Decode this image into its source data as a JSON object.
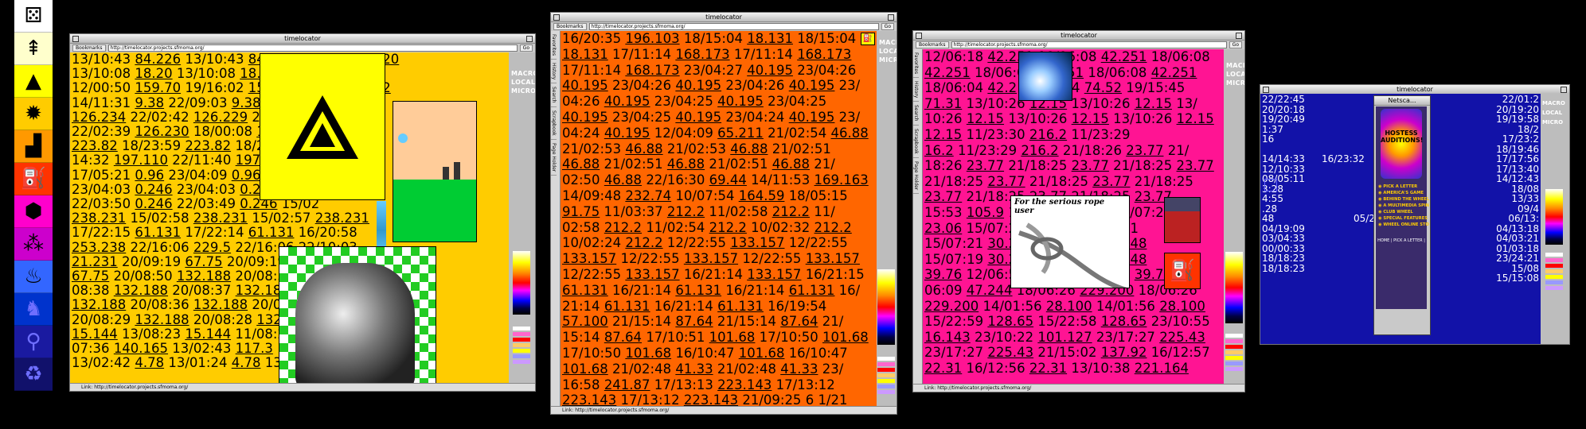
{
  "palette": {
    "items": [
      {
        "icon": "dice-icon",
        "glyph": "⚄",
        "color": "#ffffff"
      },
      {
        "icon": "tree-icon",
        "glyph": "⇞",
        "color": "#ffffcc"
      },
      {
        "icon": "triangle-icon",
        "glyph": "▲",
        "color": "#ffff00"
      },
      {
        "icon": "gear-icon",
        "glyph": "✹",
        "color": "#ffcc00"
      },
      {
        "icon": "factory-icon",
        "glyph": "▟",
        "color": "#ff9900"
      },
      {
        "icon": "fuel-pump-icon",
        "glyph": "⛽",
        "color": "#ff3300"
      },
      {
        "icon": "cube-icon",
        "glyph": "⬢",
        "color": "#ff00cc"
      },
      {
        "icon": "drops-icon",
        "glyph": "⁂",
        "color": "#cc00cc"
      },
      {
        "icon": "fire-icon",
        "glyph": "♨",
        "color": "#3366ff"
      },
      {
        "icon": "animal-icon",
        "glyph": "♞",
        "color": "#0033cc"
      },
      {
        "icon": "runner-icon",
        "glyph": "⚲",
        "color": "#1a1aa0"
      },
      {
        "icon": "recycle-icon",
        "glyph": "♻",
        "color": "#11116b"
      }
    ]
  },
  "common": {
    "window_title": "timelocator",
    "url": "http://timelocator.projects.sfmoma.org/",
    "status": "Link: http://timelocator.projects.sfmoma.org/",
    "toolbar_btn": "Bookmarks",
    "go_btn": "Go",
    "side_labels": [
      "MACRO",
      "LOCAL",
      "MICRO"
    ],
    "vtabs": [
      "Favorites",
      "History",
      "Search",
      "Scrapbook",
      "Page Holder"
    ]
  },
  "win1": {
    "bg": "#ffcc00",
    "text": "#000000",
    "rows": [
      "13/10:43 84.226 13/10:43 84.226 13/10:08 18.20",
      "13/10:08 18.20 13/10:08 18.20 22/06:52 1.227",
      "12/00:50 159.70 19/16:02 159.70 19/16:02 1.22",
      "14/11:31 9.38 22/09:03 9.38 22/09:03 14/11",
      "126.234 22/02:42 126.229 22/02:42 126.234",
      "22/02:39 126.230 18/00:08 126.230 18/00",
      "223.82 18/23:59 223.82 18/23:59 223.82",
      "14:32 197.110 22/11:40 197.110 22/11:40",
      "17/05:21 0.96 23/04:09 0.96 23/04:09 0.96",
      "23/04:03 0.246 23/04:03 0.246 23/04:03",
      "22/03:50 0.246 22/03:49 0.246 15/02",
      "238.231 15/02:58 238.231 15/02:57 238.231",
      "17/22:15 61.131 17/22:14 61.131 16/20:58",
      "253.238 22/16:06 229.5 22/16:06 22/10:03",
      "21.231 20/09:19 67.75 20/09:19 15/08:00",
      "67.75 20/08:50 132.188 20/08:50 132.188",
      "08:38 132.188 20/08:37 132.188 20/08",
      "132.188 20/08:36 132.188 20/08:36 132.188",
      "20/08:29 132.188 20/08:28 132.188 13/08:23",
      "15.144 13/08:23 15.144 11/08:23 232.86",
      "07:36 140.165 13/02:43 117.3 15/14 4.78",
      "13/02:42 4.78 13/01:24 4.78 13/01"
    ]
  },
  "win2": {
    "bg": "#ff6600",
    "text": "#000000",
    "rows": [
      "16/20:35 196.103 18/15:04 18.131 18/15:04",
      "18.131 17/11:14 168.173 17/11:14 168.173",
      "17/11:14 168.173 23/04:27 40.195 23/04:26",
      "40.195 23/04:26 40.195 23/04:26 40.195 23/",
      "04:26 40.195 23/04:25 40.195 23/04:25",
      "40.195 23/04:25 40.195 23/04:24 40.195 23/",
      "04:24 40.195 12/04:09 65.211 21/02:54 46.88",
      "21/02:53 46.88 21/02:53 46.88 21/02:51",
      "46.88 21/02:51 46.88 21/02:51 46.88 21/",
      "02:50 46.88 22/16:30 69.44 14/11:53 169.163",
      "14/09:48 232.74 10/07:54 164.59 18/05:15",
      "91.75 11/03:37 212.2 11/02:58 212.2 11/",
      "02:58 212.2 11/02:54 212.2 10/02:32 212.2",
      "10/02:24 212.2 12/22:55 133.157 12/22:55",
      "133.157 12/22:55 133.157 12/22:55 133.157",
      "12/22:55 133.157 16/21:14 133.157 16/21:15",
      "61.131 16/21:14 61.131 16/21:14 61.131 16/",
      "21:14 61.131 16/21:14 61.131 16/19:54",
      "57.100 21/15:14 87.64 21/15:14 87.64 21/",
      "15:14 87.64 17/10:51 101.68 17/10:50 101.68",
      "17/10:50 101.68 16/10:47 101.68 16/10:47",
      "101.68 21/02:48 41.33 21/02:48 41.33 23/",
      "16:58 241.87 17/13:13 223.143 17/13:12",
      "223.143 17/13:12 223.143 21/09:25 6 1/21"
    ]
  },
  "win3": {
    "bg": "#ff1493",
    "text": "#000000",
    "ad_caption": "For the serious rope user",
    "rows": [
      "12/06:18 42.251 18/06:08 42.251 18/06:08",
      "42.251 18/06:08 42.251 18/06:08 42.251",
      "18/06:04 42.2 13/13:14 74.52 19/15:45",
      "71.31 13/10:26 12.15 13/10:26 12.15 13/",
      "10:26 12.15 13/10:26 12.15 13/10:26 12.15",
      "12.15 11/23:30 216.2 11/23:29",
      "16.2 11/23:29 216.2 21/18:26 23.77 21/",
      "18:26 23.77 21/18:25 23.77 21/18:25 23.77",
      "21/18:25 23.77 21/18:25 23.77 21/18:25",
      "23.77 21/18:25 23.77 21/18:25 23.77",
      "15:53 105.9 13/08:27 16.87 11/07:21",
      "23.06 15/07:21 30.248 15/07:21",
      "15/07:21 30.248 15/07:20 30.248",
      "15/07:19 30.248 15/07:19 30.248",
      "39.76 12/06:53 39.76 12/06:53 39.76",
      "06:09 47.244 18/06:26 229.200 18/06:26",
      "229.200 14/01:56 28.100 14/01:56 28.100",
      "15/22:59 128.65 15/22:58 128.65 23/10:55",
      "16.143 23/10:22 101.127 23/17:27 225.43",
      "23/17:27 225.43 21/15:02 137.92 16/12:57",
      "22.31 16/12:56 22.31 13/10:38 221.164"
    ]
  },
  "win4": {
    "bg": "#1212a8",
    "text": "#ffffff",
    "left_rows": [
      "22/22:45",
      "20/20:18",
      "19/20:49",
      "1:37",
      "16",
      "",
      "14/14:33",
      "12/10:33",
      "08/05:11",
      "3:28",
      "4:55",
      ".28",
      "48",
      "04/19:09",
      "03/04:33",
      "00/00:33",
      "18/18:23",
      "18/18:23"
    ],
    "mid_rows": [
      "",
      "",
      "",
      "",
      "",
      "",
      "16/23:32",
      "",
      "",
      "",
      "",
      "",
      "05/2",
      "",
      "",
      "",
      "",
      ""
    ],
    "right_rows": [
      "22/01:2",
      "20/19:20",
      "19/19:58",
      "18/2",
      "17/23:2",
      "18/19:46",
      "17/17:56",
      "17/13:40",
      "14/12:43",
      "18/08",
      "13/33",
      "09/4",
      "06/13:",
      "04/13:18",
      "04/03:21",
      "01/03:18",
      "23/24:21",
      "15/08",
      "15/15:08"
    ],
    "popup": {
      "title": "Netsca...",
      "ad_line1": "HOSTESS",
      "ad_line2": "AUDITIONS!",
      "menu": [
        "PICK A LETTER",
        "AMERICA'S GAME",
        "BEHIND THE WHEEL",
        "A MULTIMEDIA SPIN",
        "CLUB WHEEL",
        "SPECIAL FEATURES",
        "WHEEL ONLINE STO"
      ],
      "footer": "HOME | PICK A LETTER |"
    }
  },
  "spectrum_swatches": [
    "#ffffff",
    "#ff66cc",
    "#ff0000",
    "#ffcc66",
    "#ffff00",
    "#9999ff",
    "#cc99ff"
  ]
}
